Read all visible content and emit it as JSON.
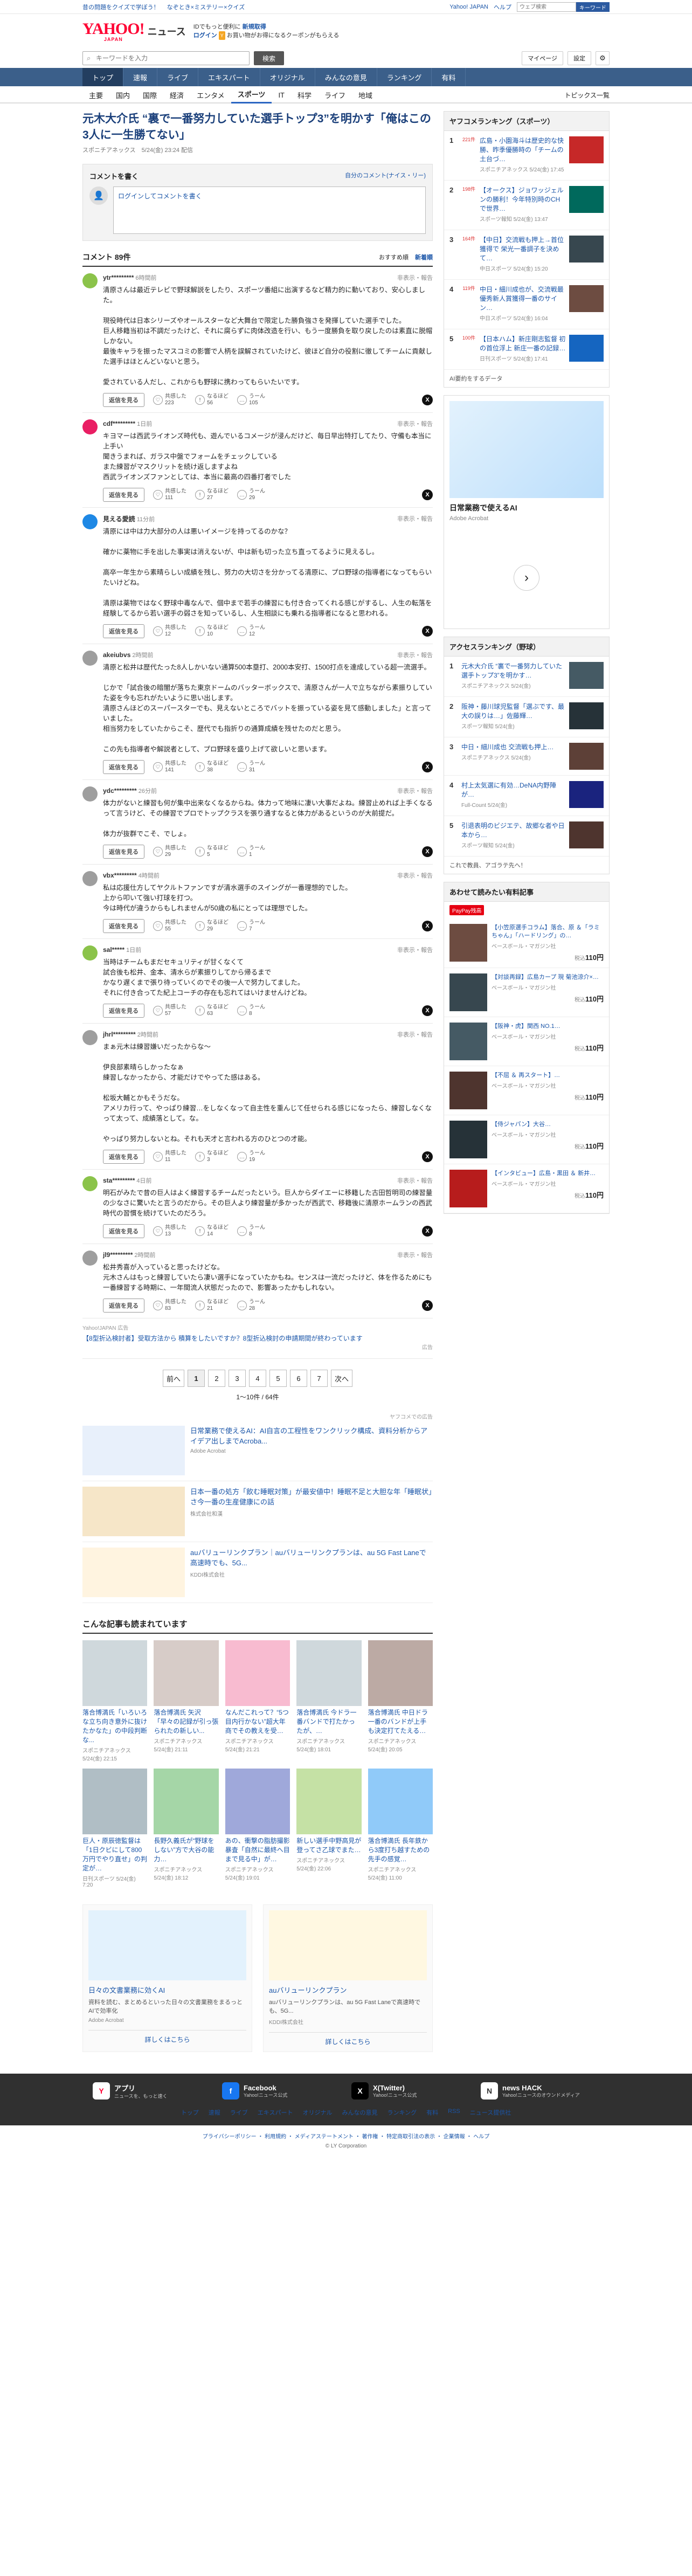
{
  "topstrip": {
    "promos": [
      "昔の問題をクイズで学ぼう！",
      "なぞとき×ミステリー×クイズ"
    ],
    "links": [
      "Yahoo! JAPAN",
      "ヘルプ"
    ],
    "search_placeholder": "ウェブ検索",
    "search_btn": "キーワード"
  },
  "header": {
    "logo": "YAHOO!",
    "logo_sub": "JAPAN",
    "brand": "ニュース",
    "msg1": "IDでもっと便利に",
    "msg1_link": "新規取得",
    "login": "ログイン",
    "badge": "Y",
    "msg2": "お買い物がお得になるクーポンがもらえる"
  },
  "search": {
    "placeholder": "キーワードを入力",
    "button": "検索",
    "mypage": "マイページ",
    "settings": "設定"
  },
  "mainnav": [
    "トップ",
    "速報",
    "ライブ",
    "エキスパート",
    "オリジナル",
    "みんなの意見",
    "ランキング",
    "有料"
  ],
  "subnav": [
    "主要",
    "国内",
    "国際",
    "経済",
    "エンタメ",
    "スポーツ",
    "IT",
    "科学",
    "ライフ",
    "地域"
  ],
  "subnav_active": 5,
  "subnav_topics": "トピックス一覧",
  "article": {
    "title": "元木大介氏 “裏で一番努力していた選手トップ3”を明かす「俺はこの3人に一生勝てない」",
    "source": "スポニチアネックス",
    "time": "5/24(金) 23:24 配信"
  },
  "commentbox": {
    "heading": "コメントを書く",
    "policy": "自分のコメント(ナイス・リー)",
    "login_prompt": "ログインしてコメントを書く"
  },
  "comments_head": {
    "count": "コメント 89件",
    "sort1": "おすすめ順",
    "sort2": "新着順"
  },
  "comment_labels": {
    "reply": "返信を見る",
    "r1a": "共感",
    "r1b": "した",
    "r2a": "なるほど",
    "r2b": "",
    "r3a": "うーん",
    "r3b": "",
    "report": "非表示・報告"
  },
  "comments": [
    {
      "user": "ytr*********",
      "time": "6時間前",
      "color": "#8bc34a",
      "text": "清原さんは最近テレビで野球解説をしたり、スポーツ番組に出演するなど精力的に動いており、安心しました。\n\n現役時代は日本シリーズやオールスターなど大舞台で限定した勝負強さを発揮していた選手でした。\n巨人移籍当初は不調だったけど、それに腐らずに肉体改造を行い、もう一度勝負を取り戻したのは素直に脱帽しかない。\n最後キャラを振ったマスコミの影響で人柄を誤解されていたけど、彼ほど自分の役割に徹してチームに貢献した選手はほとんどいないと思う。\n\n愛されている人だし、これからも野球に携わってもらいたいです。",
      "n1": "223",
      "n2": "56",
      "n3": "105"
    },
    {
      "user": "cdf*********",
      "time": "1日前",
      "color": "#e91e63",
      "text": "キヨマーは西武ライオンズ時代も、遊んでいるコメージが浸んだけど、毎日早出特打してたり、守備も本当に上手い\n聞きうまれば、ガラス中盤でフォームをチェックしている\nまた練習がマスクリットを続け返しますよね\n西武ライオンズファンとしては、本当に最高の四番打者でした",
      "n1": "111",
      "n2": "27",
      "n3": "29"
    },
    {
      "user": "見える愛読",
      "time": "11分前",
      "color": "#1e88e5",
      "text": "清原には中は力大部分の人は悪いイメージを持ってるのかな？\n\n確かに薬物に手を出した事実は消えないが、中は新も切った立ち直ってるように見えるし。\n\n高卒一年生から素晴らしい成績を残し、努力の大切さを分かってる清原に、プロ野球の指導者になってもらいたいけどね。\n\n清原は薬物ではなく野球中毒なんで、個中まで若手の練習にも付き合ってくれる感じがするし、人生の転落を経験してるから若い選手の弱さを知っているし、人生相談にも乗れる指導者になると思われる。",
      "n1": "12",
      "n2": "10",
      "n3": "12"
    },
    {
      "user": "akeiubvs",
      "time": "2時間前",
      "color": "#9e9e9e",
      "text": "清原と松井は歴代たった8人しかいない通算500本塁打、2000本安打、1500打点を達成している超一流選手。\n\nじかで「試合後の暗闇が落ちた東京ドームのバッターボックスで、清原さんが一人で立ちながら素振りしていた姿を今も忘れがたいように思い出します。\n清原さんほどのスーパースターでも、見えないところでバットを振っている姿を見て感動しました」と言っていました。\n相当努力をしていたからこそ、歴代でも指折りの通算成績を残せたのだと思う。\n\nこの先も指導者や解説者として、プロ野球を盛り上げて欲しいと思います。",
      "n1": "141",
      "n2": "38",
      "n3": "31"
    },
    {
      "user": "ydc*********",
      "time": "26分前",
      "color": "#9e9e9e",
      "text": "体力がないと練習も何が集中出来なくなるからね。体力って地味に凄い大事だよね。練習止めれば上手くなるって言うけど、その練習でプロでトップクラスを張り通すなると体力があるというのが大前提だ。\n\n体力が抜群でこそ、でしょ。",
      "n1": "29",
      "n2": "5",
      "n3": "1"
    },
    {
      "user": "vbx*********",
      "time": "4時間前",
      "color": "#9e9e9e",
      "text": "私は応援仕方してヤクルトファンですが清水選手のスイングが一番理想的でした。\n上から叩いて強い打球を打つ。\n今は時代が違うからもしれませんが50歳の私にとっては理想でした。",
      "n1": "55",
      "n2": "29",
      "n3": "7"
    },
    {
      "user": "sal*****",
      "time": "1日前",
      "color": "#8bc34a",
      "text": "当時はチームもまだセキュリティが甘くなくて\n試合後も松井、金本、清水らが素振りしてから帰るまで\nかなり遅くまで張り待っていくのでその後一人で努力してました。\nそれに付き合ってた紀上コーチの存在も忘れてはいけませんけどね。",
      "n1": "57",
      "n2": "63",
      "n3": "8"
    },
    {
      "user": "jhrl*********",
      "time": "2時間前",
      "color": "#9e9e9e",
      "text": "まぁ元木は練習嫌いだったからな〜\n\n伊良部素晴らしかったなぁ\n練習しなかったから、才能だけでやってた感はある。\n\n松坂大輔とかもそうだな。\nアメリカ行って、やっぱり練習…をしなくなって自主性を重んじて任せられる感じになったら、練習しなくなって太って、成績落として。な。\n\nやっぱり努力しないとね。それも天才と言われる方のひとつの才能。",
      "n1": "11",
      "n2": "3",
      "n3": "19"
    },
    {
      "user": "sta*********",
      "time": "4日前",
      "color": "#8bc34a",
      "text": "明石がみたで昔の巨人はよく練習するチームだったという。巨人からダイエーに移籍した古田哲明司の練習量の少なさに驚いたと言うのだから。その巨人より練習量が多かったが西武で、移籍後に清原ホームランの西武時代の習慣を続けていたのだろう。",
      "n1": "13",
      "n2": "14",
      "n3": "8"
    },
    {
      "user": "jl9*********",
      "time": "2時間前",
      "color": "#9e9e9e",
      "text": "松井秀喜が入っていると思ったけどな。\n元木さんはもっと練習していたら凄い選手になっていたかもね。センスは一流だったけど、体を作るためにも一番練習する時期に、一年間流人状態だったので、影響あったかもしれない。",
      "n1": "83",
      "n2": "21",
      "n3": "28"
    }
  ],
  "ad_inline": {
    "src": "Yahoo!JAPAN 広告",
    "text": "【8型折込検討者】受取方法から 積算をしたいですか？8型折込検討の申請期間が終わっています",
    "label": "広告"
  },
  "pager": {
    "prev": "前へ",
    "pages": [
      "1",
      "2",
      "3",
      "4",
      "5",
      "6",
      "7"
    ],
    "next": "次へ",
    "current": "1",
    "count": "1〜10件 / 64件"
  },
  "adheader": "ヤフコメでの広告",
  "ads": [
    {
      "title": "日常業務で使えるAI：AI自言の工程性をワンクリック構成、資料分析からアイデア出しまでAcroba...",
      "src": "Adobe Acrobat",
      "bg": "#e8f0fb"
    },
    {
      "title": "日本一番の処方「飲む睡眠対策」が最安値中！睡眠不足と大胆な年「睡眠状」さ今一番の生産健康にの話",
      "src": "株式会社和漢",
      "bg": "#f6e6c8"
    },
    {
      "title": "auバリューリンクプラン｜auバリューリンクプランは、au 5G Fast Laneで高速時でも、5G...",
      "src": "KDDI株式会社",
      "bg": "#fff4e0"
    }
  ],
  "related_head": "こんな記事も読まれています",
  "related": [
    {
      "title": "落合博満氏「いろいろな立ち向き意外に抜けたかなた」の中段判断な...",
      "src": "スポニチアネックス",
      "time": "5/24(金) 22:15",
      "bg": "#cfd8dc"
    },
    {
      "title": "落合博満氏 矢沢「早々の記録が引っ張られたの新しい...",
      "src": "スポニチアネックス",
      "time": "5/24(金) 21:11",
      "bg": "#d7ccc8"
    },
    {
      "title": "なんだこれって？“5つ目内行かない”超大年商でその教えを受…",
      "src": "スポニチアネックス",
      "time": "5/24(金) 21:21",
      "bg": "#f8bbd0"
    },
    {
      "title": "落合博満氏 今ドラ一番バンドで打たかったが、…",
      "src": "スポニチアネックス",
      "time": "5/24(金) 18:01",
      "bg": "#cfd8dc"
    },
    {
      "title": "落合博満氏 中日ドラ一番のバンドが上手も決定打てたえる…",
      "src": "スポニチアネックス",
      "time": "5/24(金) 20:05",
      "bg": "#bcaaa4"
    },
    {
      "title": "巨人・原辰徳監督は「1日クビにして800万円でやり直せ」の判定が…",
      "src": "日刊スポーツ",
      "time": "5/24(金) 7:20",
      "bg": "#b0bec5"
    },
    {
      "title": "長野久義氏が“野球をしない”方で大谷の能力…",
      "src": "スポニチアネックス",
      "time": "5/24(金) 18:12",
      "bg": "#a5d6a7"
    },
    {
      "title": "あの、衝撃の脂肪撮影暴査「自然に最終へ目まで見る中」が…",
      "src": "スポニチアネックス",
      "time": "5/24(金) 19:01",
      "bg": "#9fa8da"
    },
    {
      "title": "新しい選手中野高見が登ってさ乙球でまた…",
      "src": "スポニチアネックス",
      "time": "5/24(金) 22:06",
      "bg": "#c5e1a5"
    },
    {
      "title": "落合博満氏 長年鉄から3度打ち越すための先手の感覚…",
      "src": "スポニチアネックス",
      "time": "5/24(金) 11:00",
      "bg": "#90caf9"
    }
  ],
  "ads2": [
    {
      "title": "日々の文書業務に効くAI",
      "desc": "資料を読む、まとめるといった日々の文書業務をまるっとAIで効率化",
      "src": "Adobe Acrobat",
      "more": "詳しくはこちら",
      "bg": "#e3f2fd"
    },
    {
      "title": "auバリューリンクプラン",
      "desc": "auバリューリンクプランは、au 5G Fast Laneで高速時でも、5G...",
      "src": "KDDI株式会社",
      "more": "詳しくはこちら",
      "bg": "#fff8e1"
    }
  ],
  "sidebar": {
    "rank_head": "ヤフコメランキング（スポーツ）",
    "ranks": [
      {
        "n": "1",
        "c": "221件",
        "title": "広島・小園海斗は歴史的な快勝、昨季優勝時の「チームの土台づ…",
        "src": "スポニチアネックス",
        "time": "5/24(金) 17:45",
        "bg": "#c62828"
      },
      {
        "n": "2",
        "c": "198件",
        "title": "【オークス】ジョワッジェルンの勝利！今年特別時のCHで世界…",
        "src": "スポーツ報知",
        "time": "5/24(金) 13:47",
        "bg": "#00695c"
      },
      {
        "n": "3",
        "c": "164件",
        "title": "【中日】交流戦も押上→首位獲得で 栄光一番調子を決めて…",
        "src": "中日スポーツ",
        "time": "5/24(金) 15:20",
        "bg": "#37474f"
      },
      {
        "n": "4",
        "c": "119件",
        "title": "中日・細川成也が、交流戦最優秀新人賞獲得一番のサイン…",
        "src": "中日スポーツ",
        "time": "5/24(金) 16:04",
        "bg": "#6d4c41"
      },
      {
        "n": "5",
        "c": "100件",
        "title": "【日本ハム】新庄剛志監督 初の首位浮上 新庄一番の記録…",
        "src": "日刊スポーツ",
        "time": "5/24(金) 17:41",
        "bg": "#1565c0"
      }
    ],
    "rank_foot": "AI要約をするデータ",
    "ad_title": "日常業務で使えるAI",
    "ad_src": "Adobe Acrobat",
    "access_head": "アクセスランキング（野球）",
    "access": [
      {
        "n": "1",
        "title": "元木大介氏 “裏で一番努力していた選手トップ3”を明かす…",
        "src": "スポニチアネックス",
        "time": "5/24(金)",
        "bg": "#455a64"
      },
      {
        "n": "2",
        "title": "阪神・藤川球児監督「選ぶです、最大の誤りは…」佐藤輝…",
        "src": "スポーツ報知",
        "time": "5/24(金)",
        "bg": "#263238"
      },
      {
        "n": "3",
        "title": "中日・細川成也 交流戦も押上…",
        "src": "スポニチアネックス",
        "time": "5/24(金)",
        "bg": "#5d4037"
      },
      {
        "n": "4",
        "title": "村上太気選に有効…DeNA内野陣が…",
        "src": "Full-Count",
        "time": "5/24(金)",
        "bg": "#1a237e"
      },
      {
        "n": "5",
        "title": "引退表明のビジエテ、故郷な者や日本から…",
        "src": "スポーツ報知",
        "time": "5/24(金)",
        "bg": "#4e342e"
      }
    ],
    "access_foot": "これで教員、アゴラテ先へ！",
    "shop_head": "あわせて読みたい有料記事",
    "shop_badge": "PayPay残高",
    "shops": [
      {
        "title": "【小笠原選手コラム】落合、原 ＆「ラミちゃん」「ハードリング」の…",
        "src": "ベースボール・マガジン社",
        "price": "110",
        "bg": "#6d4c41"
      },
      {
        "title": "【対談再録】広島カープ 現 菊池涼介×…",
        "src": "ベースボール・マガジン社",
        "price": "110",
        "bg": "#37474f"
      },
      {
        "title": "【阪神・虎】関西 NO.1…",
        "src": "ベースボール・マガジン社",
        "price": "110",
        "bg": "#455a64"
      },
      {
        "title": "【不屈 ＆ 再スタート】…",
        "src": "ベースボール・マガジン社",
        "price": "110",
        "bg": "#4e342e"
      },
      {
        "title": "【侍ジャパン】大谷…",
        "src": "ベースボール・マガジン社",
        "price": "110",
        "bg": "#263238"
      },
      {
        "title": "【インタビュー】広島・黒田 ＆ 新井…",
        "src": "ベースボール・マガジン社",
        "price": "110",
        "bg": "#b71c1c"
      }
    ],
    "price_unit": "税込",
    "price_yen": "円"
  },
  "footer": {
    "apps": [
      {
        "name": "アプリ",
        "desc": "ニュースを、もっと速く",
        "icon": "Y",
        "bg": "#ffffff",
        "fg": "#ff0033"
      },
      {
        "name": "Facebook",
        "desc": "Yahoo!ニュース公式",
        "icon": "f",
        "bg": "#1877f2",
        "fg": "#ffffff"
      },
      {
        "name": "X(Twitter)",
        "desc": "Yahoo!ニュース公式",
        "icon": "X",
        "bg": "#000000",
        "fg": "#ffffff"
      },
      {
        "name": "news HACK",
        "desc": "Yahoo!ニュースのオウンドメディア",
        "icon": "N",
        "bg": "#ffffff",
        "fg": "#333333"
      }
    ],
    "nav": [
      "トップ",
      "速報",
      "ライブ",
      "エキスパート",
      "オリジナル",
      "みんなの意見",
      "ランキング",
      "有料",
      "RSS",
      "ニュース提供社"
    ],
    "links": "プライバシーポリシー ・ 利用規約 ・ メディアステートメント ・ 著作権 ・ 特定商取引法の表示 ・ 企業情報 ・ ヘルプ",
    "copy": "© LY Corporation"
  }
}
